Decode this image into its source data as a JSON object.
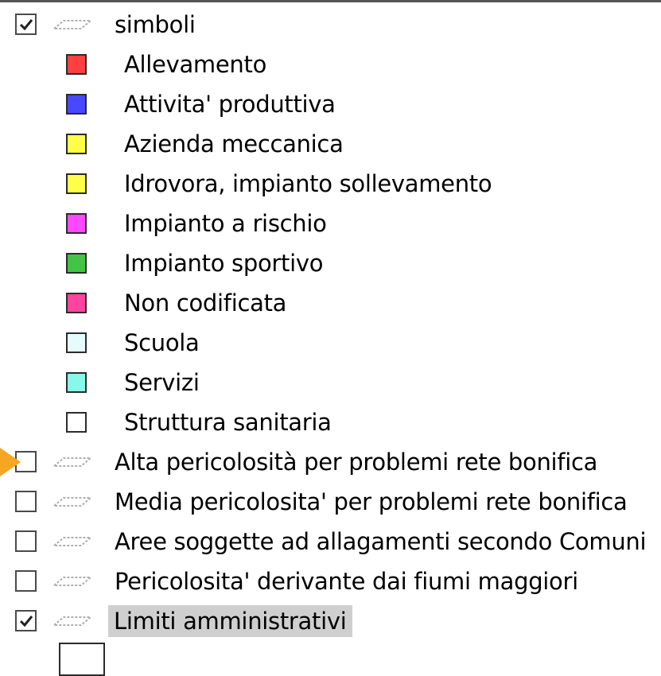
{
  "layers": [
    {
      "label": "simboli",
      "checked": true,
      "selected": false
    },
    {
      "label": "Alta pericolosità per problemi rete bonifica",
      "checked": false,
      "selected": false
    },
    {
      "label": "Media pericolosita' per problemi rete bonifica",
      "checked": false,
      "selected": false
    },
    {
      "label": "Aree soggette ad allagamenti secondo Comuni",
      "checked": false,
      "selected": false
    },
    {
      "label": "Pericolosita' derivante dai fiumi maggiori",
      "checked": false,
      "selected": false
    },
    {
      "label": "Limiti amministrativi",
      "checked": true,
      "selected": true
    }
  ],
  "legend": [
    {
      "label": "Allevamento",
      "color": "#ff4040"
    },
    {
      "label": "Attivita' produttiva",
      "color": "#4848ff"
    },
    {
      "label": "Azienda meccanica",
      "color": "#ffff48"
    },
    {
      "label": "Idrovora, impianto sollevamento",
      "color": "#ffff48"
    },
    {
      "label": "Impianto a rischio",
      "color": "#ff48ff"
    },
    {
      "label": "Impianto sportivo",
      "color": "#44c444"
    },
    {
      "label": "Non codificata",
      "color": "#ff44a0"
    },
    {
      "label": "Scuola",
      "color": "#e4fcfc"
    },
    {
      "label": "Servizi",
      "color": "#88f8e8"
    },
    {
      "label": "Struttura sanitaria",
      "color": "#ffffff"
    }
  ],
  "pointer_color": "#f5a623",
  "icons": {
    "checkbox": "checkbox-icon",
    "layer_line": "line-layer-icon",
    "pointer": "arrow-pointer-icon"
  }
}
